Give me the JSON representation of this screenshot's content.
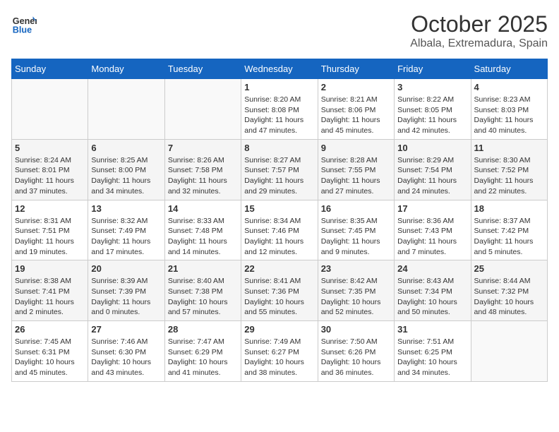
{
  "header": {
    "logo_general": "General",
    "logo_blue": "Blue",
    "title": "October 2025",
    "subtitle": "Albala, Extremadura, Spain"
  },
  "weekdays": [
    "Sunday",
    "Monday",
    "Tuesday",
    "Wednesday",
    "Thursday",
    "Friday",
    "Saturday"
  ],
  "weeks": [
    [
      {
        "day": "",
        "info": ""
      },
      {
        "day": "",
        "info": ""
      },
      {
        "day": "",
        "info": ""
      },
      {
        "day": "1",
        "info": "Sunrise: 8:20 AM\nSunset: 8:08 PM\nDaylight: 11 hours and 47 minutes."
      },
      {
        "day": "2",
        "info": "Sunrise: 8:21 AM\nSunset: 8:06 PM\nDaylight: 11 hours and 45 minutes."
      },
      {
        "day": "3",
        "info": "Sunrise: 8:22 AM\nSunset: 8:05 PM\nDaylight: 11 hours and 42 minutes."
      },
      {
        "day": "4",
        "info": "Sunrise: 8:23 AM\nSunset: 8:03 PM\nDaylight: 11 hours and 40 minutes."
      }
    ],
    [
      {
        "day": "5",
        "info": "Sunrise: 8:24 AM\nSunset: 8:01 PM\nDaylight: 11 hours and 37 minutes."
      },
      {
        "day": "6",
        "info": "Sunrise: 8:25 AM\nSunset: 8:00 PM\nDaylight: 11 hours and 34 minutes."
      },
      {
        "day": "7",
        "info": "Sunrise: 8:26 AM\nSunset: 7:58 PM\nDaylight: 11 hours and 32 minutes."
      },
      {
        "day": "8",
        "info": "Sunrise: 8:27 AM\nSunset: 7:57 PM\nDaylight: 11 hours and 29 minutes."
      },
      {
        "day": "9",
        "info": "Sunrise: 8:28 AM\nSunset: 7:55 PM\nDaylight: 11 hours and 27 minutes."
      },
      {
        "day": "10",
        "info": "Sunrise: 8:29 AM\nSunset: 7:54 PM\nDaylight: 11 hours and 24 minutes."
      },
      {
        "day": "11",
        "info": "Sunrise: 8:30 AM\nSunset: 7:52 PM\nDaylight: 11 hours and 22 minutes."
      }
    ],
    [
      {
        "day": "12",
        "info": "Sunrise: 8:31 AM\nSunset: 7:51 PM\nDaylight: 11 hours and 19 minutes."
      },
      {
        "day": "13",
        "info": "Sunrise: 8:32 AM\nSunset: 7:49 PM\nDaylight: 11 hours and 17 minutes."
      },
      {
        "day": "14",
        "info": "Sunrise: 8:33 AM\nSunset: 7:48 PM\nDaylight: 11 hours and 14 minutes."
      },
      {
        "day": "15",
        "info": "Sunrise: 8:34 AM\nSunset: 7:46 PM\nDaylight: 11 hours and 12 minutes."
      },
      {
        "day": "16",
        "info": "Sunrise: 8:35 AM\nSunset: 7:45 PM\nDaylight: 11 hours and 9 minutes."
      },
      {
        "day": "17",
        "info": "Sunrise: 8:36 AM\nSunset: 7:43 PM\nDaylight: 11 hours and 7 minutes."
      },
      {
        "day": "18",
        "info": "Sunrise: 8:37 AM\nSunset: 7:42 PM\nDaylight: 11 hours and 5 minutes."
      }
    ],
    [
      {
        "day": "19",
        "info": "Sunrise: 8:38 AM\nSunset: 7:41 PM\nDaylight: 11 hours and 2 minutes."
      },
      {
        "day": "20",
        "info": "Sunrise: 8:39 AM\nSunset: 7:39 PM\nDaylight: 11 hours and 0 minutes."
      },
      {
        "day": "21",
        "info": "Sunrise: 8:40 AM\nSunset: 7:38 PM\nDaylight: 10 hours and 57 minutes."
      },
      {
        "day": "22",
        "info": "Sunrise: 8:41 AM\nSunset: 7:36 PM\nDaylight: 10 hours and 55 minutes."
      },
      {
        "day": "23",
        "info": "Sunrise: 8:42 AM\nSunset: 7:35 PM\nDaylight: 10 hours and 52 minutes."
      },
      {
        "day": "24",
        "info": "Sunrise: 8:43 AM\nSunset: 7:34 PM\nDaylight: 10 hours and 50 minutes."
      },
      {
        "day": "25",
        "info": "Sunrise: 8:44 AM\nSunset: 7:32 PM\nDaylight: 10 hours and 48 minutes."
      }
    ],
    [
      {
        "day": "26",
        "info": "Sunrise: 7:45 AM\nSunset: 6:31 PM\nDaylight: 10 hours and 45 minutes."
      },
      {
        "day": "27",
        "info": "Sunrise: 7:46 AM\nSunset: 6:30 PM\nDaylight: 10 hours and 43 minutes."
      },
      {
        "day": "28",
        "info": "Sunrise: 7:47 AM\nSunset: 6:29 PM\nDaylight: 10 hours and 41 minutes."
      },
      {
        "day": "29",
        "info": "Sunrise: 7:49 AM\nSunset: 6:27 PM\nDaylight: 10 hours and 38 minutes."
      },
      {
        "day": "30",
        "info": "Sunrise: 7:50 AM\nSunset: 6:26 PM\nDaylight: 10 hours and 36 minutes."
      },
      {
        "day": "31",
        "info": "Sunrise: 7:51 AM\nSunset: 6:25 PM\nDaylight: 10 hours and 34 minutes."
      },
      {
        "day": "",
        "info": ""
      }
    ]
  ]
}
